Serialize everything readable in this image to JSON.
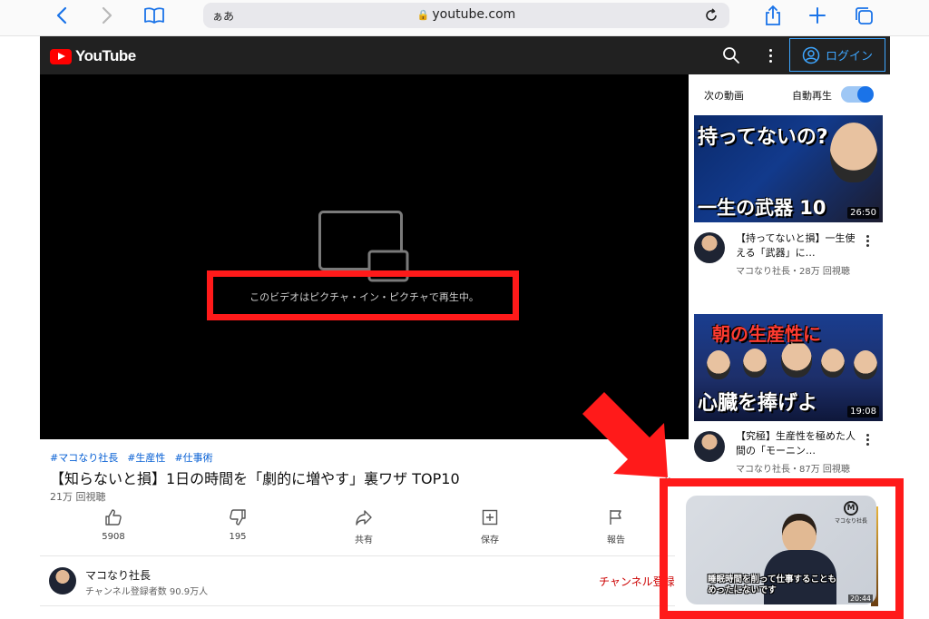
{
  "browser": {
    "address_aa": "ぁあ",
    "url": "youtube.com",
    "colors": {
      "accent": "#1a73e8"
    }
  },
  "header": {
    "logo_text": "YouTube",
    "login_label": "ログイン"
  },
  "player": {
    "pip_message": "このビデオはピクチャ・イン・ピクチャで再生中。"
  },
  "video": {
    "hashtags": [
      "#マコなり社長",
      "#生産性",
      "#仕事術"
    ],
    "title": "【知らないと損】1日の時間を「劇的に増やす」裏ワザ TOP10",
    "views": "21万 回視聴",
    "actions": {
      "like": "5908",
      "dislike": "195",
      "share": "共有",
      "save": "保存",
      "report": "報告"
    }
  },
  "channel": {
    "name": "マコなり社長",
    "subscribers": "チャンネル登録者数 90.9万人",
    "subscribe_label": "チャンネル登録"
  },
  "sidebar": {
    "up_next_label": "次の動画",
    "autoplay_label": "自動再生",
    "autoplay_on": true,
    "items": [
      {
        "thumb_line1": "持ってないの?",
        "thumb_line2": "一生の武器 10",
        "duration": "26:50",
        "title": "【持ってないと損】一生使える「武器」に…",
        "meta": "マコなり社長・28万 回視聴"
      },
      {
        "thumb_line1": "朝の生産性に",
        "thumb_line2": "心臓を捧げよ",
        "duration": "19:08",
        "title": "【究極】生産性を極めた人間の「モーニン…",
        "meta": "マコなり社長・87万 回視聴"
      }
    ]
  },
  "pip_window": {
    "brand_text": "マコなり社長",
    "caption_line1": "睡眠時間を削って仕事することも",
    "caption_line2": "めったにないです",
    "time": "20:44"
  },
  "annotations": {
    "highlight_color": "#ff1a1a"
  }
}
